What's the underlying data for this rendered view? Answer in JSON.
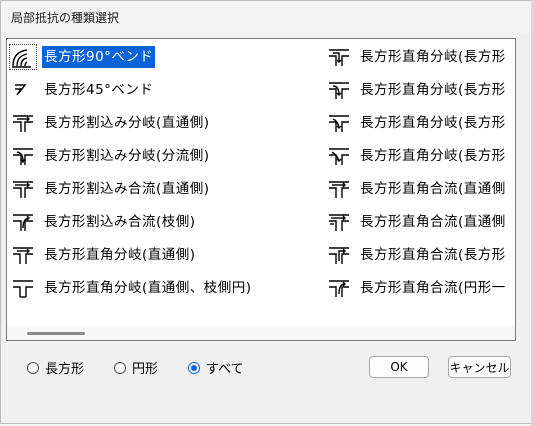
{
  "window": {
    "title": "局部抵抗の種類選択"
  },
  "list": {
    "left_column": [
      {
        "label": "長方形90°ベンド",
        "icon": "bend90-icon",
        "selected": true
      },
      {
        "label": "長方形45°ベンド",
        "icon": "bend45-icon"
      },
      {
        "label": "長方形割込み分岐(直通側)",
        "icon": "branch-insert-straight-icon"
      },
      {
        "label": "長方形割込み分岐(分流側)",
        "icon": "branch-insert-divert-icon"
      },
      {
        "label": "長方形割込み合流(直通側)",
        "icon": "merge-insert-straight-icon"
      },
      {
        "label": "長方形割込み合流(枝側)",
        "icon": "merge-insert-branch-icon"
      },
      {
        "label": "長方形直角分岐(直通側)",
        "icon": "tee-branch-straight-icon"
      },
      {
        "label": "長方形直角分岐(直通側、枝側円)",
        "icon": "tee-branch-round-icon"
      }
    ],
    "right_column": [
      {
        "label": "長方形直角分岐(長方形",
        "icon": "rect-tee-branch-icon"
      },
      {
        "label": "長方形直角分岐(長方形",
        "icon": "rect-tee-branch-icon"
      },
      {
        "label": "長方形直角分岐(長方形",
        "icon": "rect-tee-branch-icon"
      },
      {
        "label": "長方形直角分岐(長方形",
        "icon": "rect-tee-branch-icon"
      },
      {
        "label": "長方形直角合流(直通側",
        "icon": "rect-tee-merge-icon"
      },
      {
        "label": "長方形直角合流(直通側",
        "icon": "rect-tee-merge-icon"
      },
      {
        "label": "長方形直角合流(長方形",
        "icon": "rect-tee-merge-icon"
      },
      {
        "label": "長方形直角合流(円形一",
        "icon": "rect-tee-merge-round-icon"
      }
    ]
  },
  "filters": {
    "rect": "長方形",
    "round": "円形",
    "all": "すべて",
    "selected": "all"
  },
  "buttons": {
    "ok": "OK",
    "cancel": "キャンセル"
  },
  "colors": {
    "selection": "#0a64d8"
  }
}
